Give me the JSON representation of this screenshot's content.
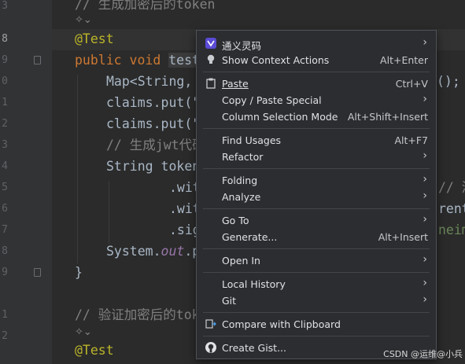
{
  "editor": {
    "line_numbers": [
      "8",
      "9",
      "0",
      "1",
      "2",
      "3",
      "4",
      "5",
      "6",
      "7",
      "8",
      "9",
      "0",
      "1",
      "2",
      "3"
    ],
    "active_line_number": "8",
    "comment_token": "// 生成加密后的token",
    "ai_hint": "✧⌄",
    "annotation": "@Test",
    "method_kw_public": "public",
    "method_kw_void": "void",
    "method_name_partial": "test",
    "map_line": "Map<String,",
    "map_line_end": "();",
    "claims_put_1": "claims.put(\"",
    "claims_put_2": "claims.put(\"",
    "comment_jwt": "// 生成jwt代码",
    "string_token": "String token",
    "with_1": ".wit",
    "with_1_comment": "// 添",
    "with_2": ".wit",
    "with_2_tail": "rent",
    "sig": ".sig",
    "sig_tail": "neima",
    "system_out": "System.",
    "system_out_it": "out",
    "system_out_end": ".p",
    "close_brace": "}",
    "comment_verify": "// 验证加密后的tok",
    "ai_hint_2": "✧⌄",
    "annotation_2": "@Test"
  },
  "menu": {
    "items": [
      {
        "label": "通义灵码",
        "shortcut": "",
        "submenu": true
      },
      {
        "label": "Show Context Actions",
        "shortcut": "Alt+Enter",
        "submenu": false
      },
      {
        "label": "Paste",
        "shortcut": "Ctrl+V",
        "submenu": false
      },
      {
        "label": "Copy / Paste Special",
        "shortcut": "",
        "submenu": true
      },
      {
        "label": "Column Selection Mode",
        "shortcut": "Alt+Shift+Insert",
        "submenu": false
      },
      {
        "label": "Find Usages",
        "shortcut": "Alt+F7",
        "submenu": false
      },
      {
        "label": "Refactor",
        "shortcut": "",
        "submenu": true
      },
      {
        "label": "Folding",
        "shortcut": "",
        "submenu": true
      },
      {
        "label": "Analyze",
        "shortcut": "",
        "submenu": true
      },
      {
        "label": "Go To",
        "shortcut": "",
        "submenu": true
      },
      {
        "label": "Generate...",
        "shortcut": "Alt+Insert",
        "submenu": false
      },
      {
        "label": "Open In",
        "shortcut": "",
        "submenu": true
      },
      {
        "label": "Local History",
        "shortcut": "",
        "submenu": true
      },
      {
        "label": "Git",
        "shortcut": "",
        "submenu": true
      },
      {
        "label": "Compare with Clipboard",
        "shortcut": "",
        "submenu": false
      },
      {
        "label": "Create Gist...",
        "shortcut": "",
        "submenu": false
      }
    ]
  },
  "watermark": "CSDN @运维@小兵",
  "colors": {
    "editor_bg": "#2b2b2b",
    "gutter_bg": "#313335",
    "menu_bg": "#2b2d30",
    "keyword": "#cc7832",
    "annotation": "#bbb529",
    "comment": "#808080"
  }
}
